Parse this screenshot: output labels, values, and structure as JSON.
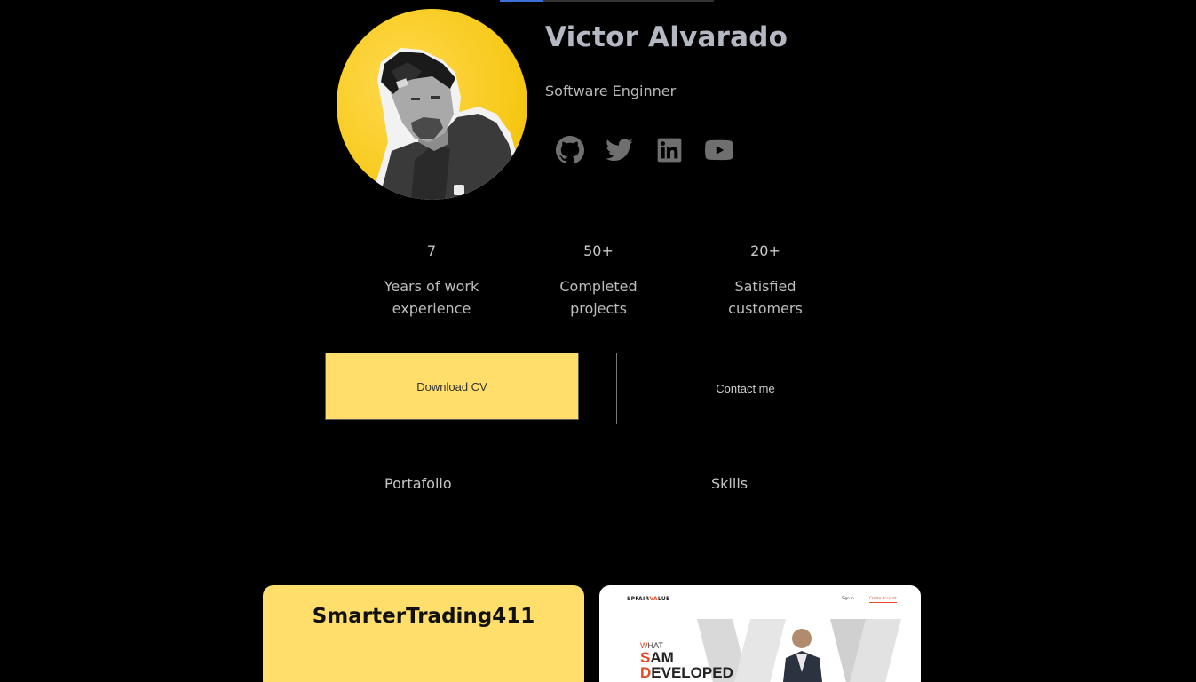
{
  "header": {
    "scroll_progress": 0.2
  },
  "profile": {
    "name": "Victor Alvarado",
    "role": "Software Enginner",
    "avatar_color": "#f6c815"
  },
  "socials": [
    {
      "icon": "github-icon"
    },
    {
      "icon": "twitter-icon"
    },
    {
      "icon": "linkedin-icon"
    },
    {
      "icon": "youtube-icon"
    }
  ],
  "stats": [
    {
      "value": "7",
      "label_lines": [
        "Years of work",
        "experience"
      ]
    },
    {
      "value": "50+",
      "label_lines": [
        "Completed",
        "projects"
      ]
    },
    {
      "value": "20+",
      "label_lines": [
        "Satisfied",
        "customers"
      ]
    }
  ],
  "buttons": {
    "download": "Download CV",
    "contact": "Contact me"
  },
  "tabs": [
    "Portafolio",
    "Skills"
  ],
  "projects": [
    {
      "title": "SmarterTrading411",
      "color": "#ffde6b"
    },
    {
      "thumb": {
        "brand_prefix": "SPFAIR",
        "brand_accent": "VA",
        "brand_suffix": "LUE",
        "nav_signin": "Sign In",
        "nav_cta": "Create Account",
        "headline_l1_first": "W",
        "headline_l1_rest": "HAT",
        "headline_l2_first": "S",
        "headline_l2_rest": "AM",
        "headline_l3_first": "D",
        "headline_l3_rest": "EVELOPED"
      }
    }
  ],
  "colors": {
    "background": "#000000",
    "accent": "#ffde6b",
    "name_text": "#b4b8c2",
    "icon": "#6f6f6f"
  }
}
